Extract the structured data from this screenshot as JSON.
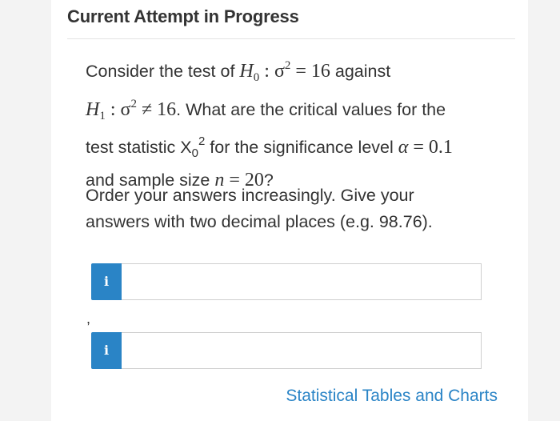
{
  "header": {
    "title": "Current Attempt in Progress"
  },
  "question": {
    "line1_pre": "Consider the test of ",
    "h0_label": "H",
    "h0_sub": "0",
    "h0_colon": " : ",
    "sigma": "σ",
    "sq": "2",
    "equals_16": " = 16",
    "against": " against",
    "h1_label": "H",
    "h1_sub": "1",
    "h1_colon": " : ",
    "neq_16": " ≠ 16",
    "line2_post": ". What are the critical values for the",
    "line3_pre": "test statistic ",
    "x_label": "X",
    "x_sub": "0",
    "x_sup": "2",
    "line3_mid": " for the significance level ",
    "alpha": "α",
    "alpha_val": " = 0.1",
    "line4_pre": "and sample size ",
    "n_label": "n",
    "n_val": " = 20",
    "line4_post": "?"
  },
  "instructions": {
    "line1": "Order your answers increasingly. Give your",
    "line2": "answers with two decimal places (e.g. 98.76)."
  },
  "answers": [
    {
      "info_label": "i",
      "value": "",
      "placeholder": ""
    },
    {
      "info_label": "i",
      "value": "",
      "placeholder": ""
    }
  ],
  "separator": ",",
  "link": {
    "label": "Statistical Tables and Charts"
  },
  "colors": {
    "accent": "#2a84c6",
    "text": "#333333"
  }
}
